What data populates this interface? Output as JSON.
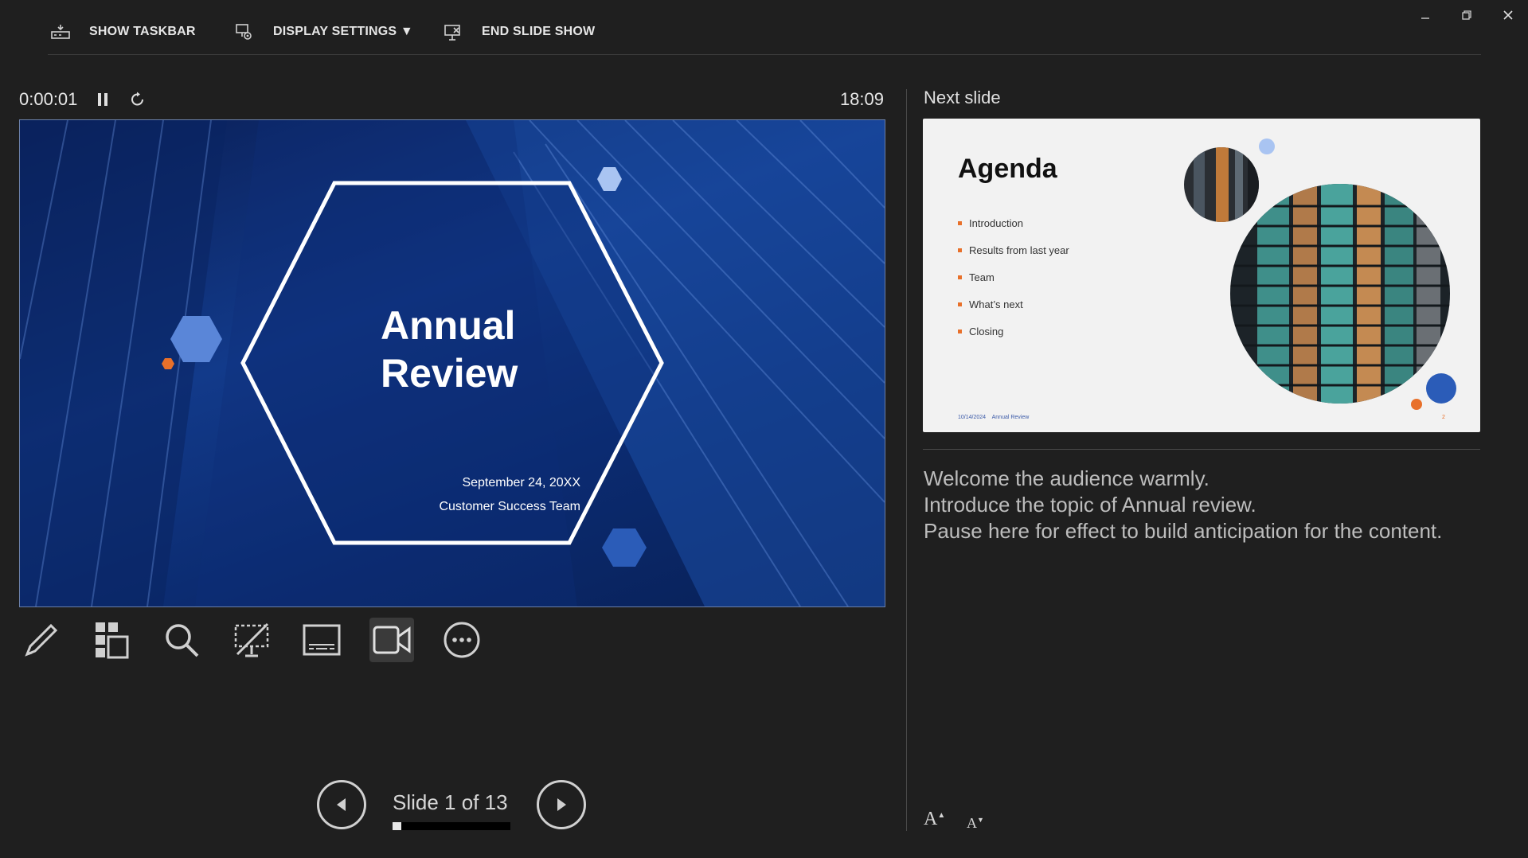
{
  "toolbar": {
    "show_taskbar": "SHOW TASKBAR",
    "display_settings": "DISPLAY SETTINGS ▼",
    "end_slide_show": "END SLIDE SHOW"
  },
  "window": {
    "minimize": "–",
    "restore": "🗗",
    "close": "✕"
  },
  "timer": {
    "elapsed": "0:00:01",
    "clock": "18:09"
  },
  "current_slide": {
    "title_line1": "Annual",
    "title_line2": "Review",
    "date": "September 24, 20XX",
    "team": "Customer Success Team"
  },
  "tools": [
    {
      "name": "pen-tool",
      "icon": "pen-icon"
    },
    {
      "name": "see-all-slides",
      "icon": "grid-icon"
    },
    {
      "name": "zoom-into-slide",
      "icon": "magnifier-icon"
    },
    {
      "name": "black-screen",
      "icon": "presentation-off-icon"
    },
    {
      "name": "subtitles",
      "icon": "subtitles-icon"
    },
    {
      "name": "camera-toggle",
      "icon": "camera-icon"
    },
    {
      "name": "more-options",
      "icon": "more-icon"
    }
  ],
  "navigation": {
    "slide_counter": "Slide 1 of 13",
    "progress_fraction": 0.077
  },
  "next_slide": {
    "label": "Next slide",
    "title": "Agenda",
    "items": [
      "Introduction",
      "Results from last year",
      "Team",
      "What’s next",
      "Closing"
    ],
    "footer_date": "10/14/2024",
    "footer_title": "Annual Review",
    "page_number": "2"
  },
  "notes": [
    "Welcome the audience warmly.",
    "Introduce the topic of Annual review.",
    "Pause here for effect to build anticipation for the content."
  ],
  "font_controls": {
    "increase": "A",
    "decrease": "A"
  },
  "colors": {
    "background": "#1f1f1f",
    "slide_blue": "#123a8a",
    "accent_orange": "#e8702a",
    "accent_light_blue": "#7ea2e6"
  }
}
